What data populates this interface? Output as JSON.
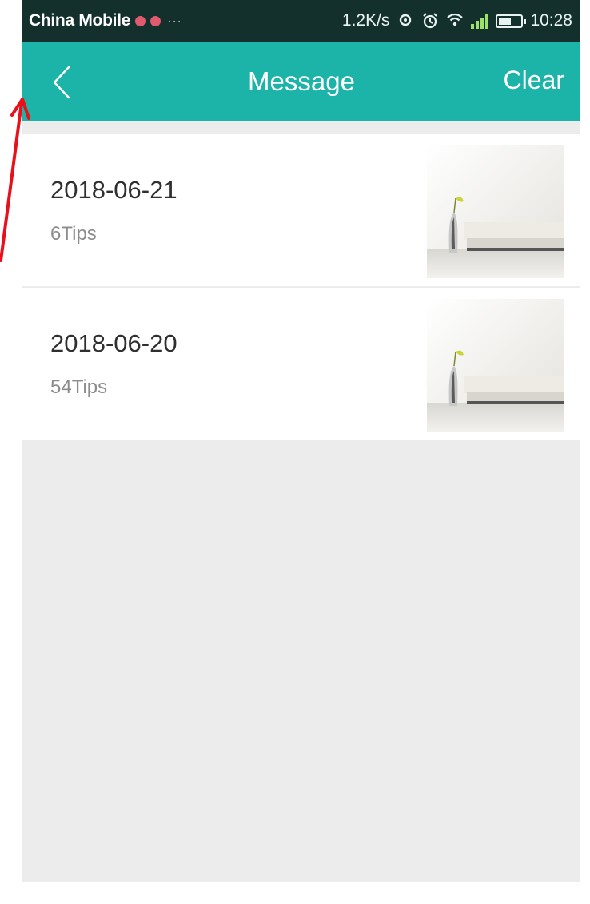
{
  "status_bar": {
    "carrier": "China Mobile",
    "ellipsis": "···",
    "speed": "1.2K/s",
    "time": "10:28",
    "icons": [
      "notification-badge-icon",
      "notification-badge-icon",
      "sync-icon",
      "alarm-icon",
      "wifi-icon",
      "signal-icon",
      "battery-icon"
    ]
  },
  "header": {
    "title": "Message",
    "clear_label": "Clear",
    "back_icon": "chevron-left-icon",
    "color": "#1cb3a8"
  },
  "messages": [
    {
      "date": "2018-06-21",
      "tips": "6Tips",
      "thumbnail": "living-room-image"
    },
    {
      "date": "2018-06-20",
      "tips": "54Tips",
      "thumbnail": "living-room-image"
    }
  ],
  "annotation": {
    "color": "#e8111b",
    "shape": "arrow"
  }
}
